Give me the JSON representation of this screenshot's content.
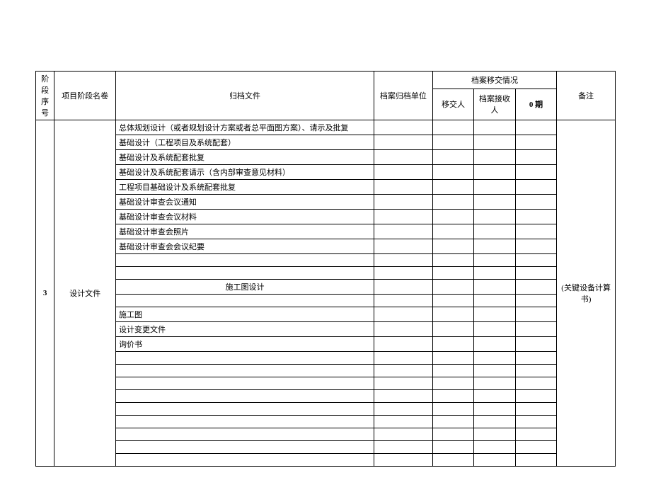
{
  "header": {
    "seq": "阶段序号",
    "stage": "项目阶段名卷",
    "doc": "归档文件",
    "unit": "档案归档单位",
    "transfer_group": "档案移交情况",
    "transfer": "移交人",
    "receiver": "档案接收人",
    "period": "0 期",
    "remark": "备注"
  },
  "body": {
    "seq_value": "3",
    "stage_value": "设计文件",
    "remark_value": "(关键设备计算书)",
    "rows": [
      "总体规划设计（或者规划设计方案或者总平面图方案）、请示及批复",
      "基础设计（工程项目及系统配套）",
      "基础设计及系统配套批复",
      "基础设计及系统配套请示（含内部审查意见材料）",
      "工程项目基础设计及系统配套批复",
      "基础设计审查会议通知",
      "基础设计审查会议材料",
      "基础设计审查会照片",
      "基础设计审查会会议纪要",
      "",
      "",
      "施工图设计",
      "",
      "施工图",
      "设计变更文件",
      "询价书",
      "",
      "",
      "",
      "",
      "",
      "",
      "",
      "",
      ""
    ],
    "center_rows": [
      11
    ]
  }
}
